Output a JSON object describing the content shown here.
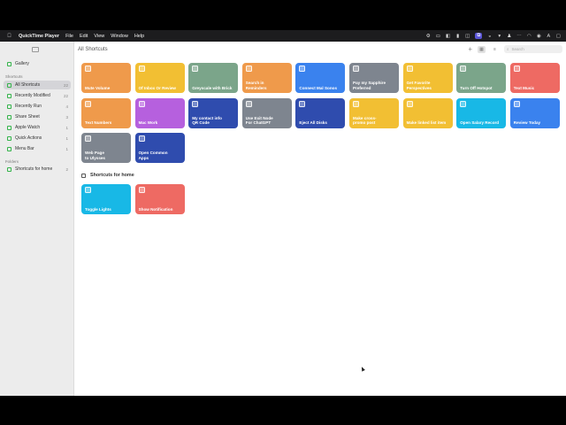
{
  "menubar": {
    "apple": "",
    "app_name": "QuickTime Player",
    "items": [
      "File",
      "Edit",
      "View",
      "Window",
      "Help"
    ],
    "status_icons": [
      "gear-icon",
      "display-icon",
      "bag-icon",
      "bookmark-icon",
      "screen-record-icon",
      "drive-icon",
      "bell-icon",
      "wifi-icon",
      "person-icon",
      "wifi-icon",
      "control-center-icon",
      "keyboard-icon",
      "display-icon"
    ]
  },
  "window": {
    "title": "All Shortcuts",
    "search_placeholder": "Search"
  },
  "sidebar": {
    "gallery": "Gallery",
    "shortcuts_header": "Shortcuts",
    "items": [
      {
        "label": "All Shortcuts",
        "count": "22",
        "selected": true
      },
      {
        "label": "Recently Modified",
        "count": "22"
      },
      {
        "label": "Recently Run",
        "count": "4"
      },
      {
        "label": "Share Sheet",
        "count": "3"
      },
      {
        "label": "Apple Watch",
        "count": "1"
      },
      {
        "label": "Quick Actions",
        "count": "1"
      },
      {
        "label": "Menu Bar",
        "count": "1"
      }
    ],
    "folders_header": "Folders",
    "folders": [
      {
        "label": "Shortcuts for home",
        "count": "2"
      }
    ]
  },
  "tiles": [
    {
      "label": "Mute Volume",
      "color": "#ef9a4b"
    },
    {
      "label": "Of Inbox Or Review",
      "color": "#f2bf33"
    },
    {
      "label": "Greyscale with Brick",
      "color": "#7ba58a"
    },
    {
      "label": "Search in\nReminders",
      "color": "#ef9a4b"
    },
    {
      "label": "Connect Mal Sonos",
      "color": "#3a82ee"
    },
    {
      "label": "Pay my Sapphire\nPreferred",
      "color": "#7e858f"
    },
    {
      "label": "Get Favorite\nPerspectives",
      "color": "#f2bf33"
    },
    {
      "label": "Turn Off Hotspot",
      "color": "#7ba58a"
    },
    {
      "label": "Text Music",
      "color": "#ee6a63"
    },
    {
      "label": "Text Numbers",
      "color": "#ef9a4b"
    },
    {
      "label": "Mac Work",
      "color": "#b660de"
    },
    {
      "label": "My contact info\nQR Code",
      "color": "#2f4cae"
    },
    {
      "label": "Use Exit Node\nFor ChatGPT",
      "color": "#7e858f"
    },
    {
      "label": "Eject All Disks",
      "color": "#2f4cae"
    },
    {
      "label": "Make cross-\npromo post",
      "color": "#f2bf33"
    },
    {
      "label": "Make linked list item",
      "color": "#f2bf33"
    },
    {
      "label": "Open Salary Record",
      "color": "#18b8e6"
    },
    {
      "label": "Review Today",
      "color": "#3a82ee"
    },
    {
      "label": "Web Page\nto Ulysses",
      "color": "#7e858f"
    },
    {
      "label": "Open Common\nApps",
      "color": "#2f4cae"
    }
  ],
  "folder_section": {
    "title": "Shortcuts for home",
    "tiles": [
      {
        "label": "Toggle Lights",
        "color": "#18b8e6"
      },
      {
        "label": "Show Notification",
        "color": "#ee6a63"
      }
    ]
  }
}
